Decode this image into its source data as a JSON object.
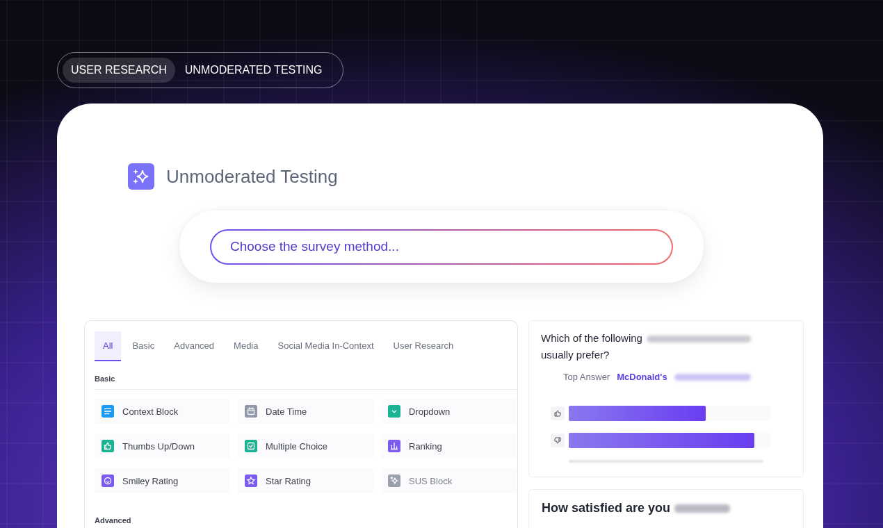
{
  "breadcrumb": [
    {
      "label": "USER RESEARCH",
      "selected": true
    },
    {
      "label": "UNMODERATED TESTING",
      "selected": false
    }
  ],
  "title": "Unmoderated Testing",
  "search": {
    "placeholder": "Choose the survey method..."
  },
  "tabs": [
    {
      "label": "All",
      "selected": true
    },
    {
      "label": "Basic",
      "selected": false
    },
    {
      "label": "Advanced",
      "selected": false
    },
    {
      "label": "Media",
      "selected": false
    },
    {
      "label": "Social Media In-Context",
      "selected": false
    },
    {
      "label": "User Research",
      "selected": false
    }
  ],
  "sections": [
    {
      "heading": "Basic",
      "items": [
        {
          "label": "Context Block",
          "kind": "lines",
          "color": "#1a9af0",
          "disabled": false
        },
        {
          "label": "Date Time",
          "kind": "calendar",
          "color": "#8f97a6",
          "disabled": false
        },
        {
          "label": "Dropdown",
          "kind": "chevron",
          "color": "#1cb394",
          "disabled": false
        },
        {
          "label": "Thumbs Up/Down",
          "kind": "thumb",
          "color": "#1cb394",
          "disabled": false
        },
        {
          "label": "Multiple Choice",
          "kind": "check",
          "color": "#1cb394",
          "disabled": false
        },
        {
          "label": "Ranking",
          "kind": "bars",
          "color": "#7c5cf0",
          "disabled": false
        },
        {
          "label": "Smiley Rating",
          "kind": "smiley",
          "color": "#7c5cf0",
          "disabled": false
        },
        {
          "label": "Star Rating",
          "kind": "star",
          "color": "#7c5cf0",
          "disabled": false
        },
        {
          "label": "SUS Block",
          "kind": "sparkle",
          "color": "#9aa1ad",
          "disabled": true
        }
      ]
    },
    {
      "heading": "Advanced"
    }
  ],
  "question_card": {
    "question_start": "Which of the following",
    "question_end": "usually prefer?",
    "top_answer_label": "Top Answer",
    "top_answer": "McDonald's",
    "bars": [
      {
        "kind": "up",
        "level": 0.68
      },
      {
        "kind": "down",
        "level": 0.92
      }
    ]
  },
  "second_card": {
    "question": "How satisfied are you"
  }
}
